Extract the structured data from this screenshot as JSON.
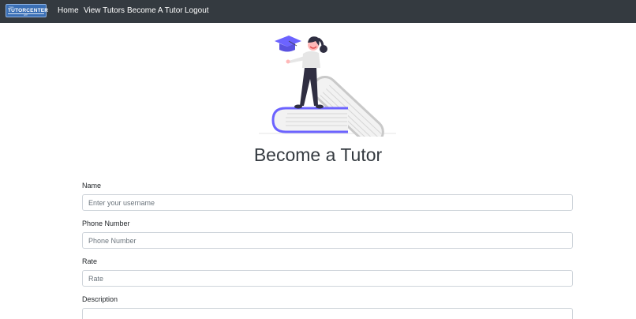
{
  "navbar": {
    "brand": {
      "small_text": "THE",
      "name": "TUTORCENTER",
      "sub_text": "APP"
    },
    "links": [
      "Home",
      "View Tutors",
      "Become A Tutor",
      "Logout"
    ]
  },
  "page": {
    "title": "Become a Tutor"
  },
  "form": {
    "name": {
      "label": "Name",
      "placeholder": "Enter your username"
    },
    "phone": {
      "label": "Phone Number",
      "placeholder": "Phone Number"
    },
    "rate": {
      "label": "Rate",
      "placeholder": "Rate"
    },
    "description": {
      "label": "Description",
      "placeholder": ""
    }
  },
  "colors": {
    "navbar_bg": "#343a40",
    "accent": "#6c63ff",
    "brand_bg": "#3a6fb5"
  }
}
